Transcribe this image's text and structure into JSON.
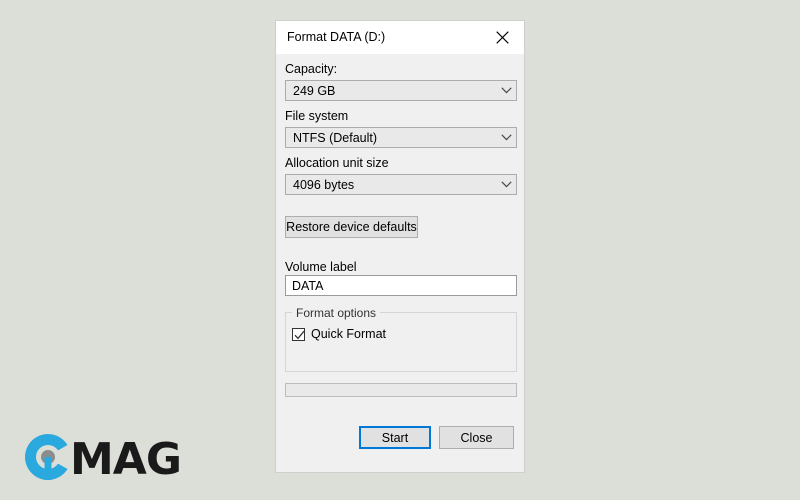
{
  "window": {
    "title": "Format DATA (D:)",
    "close_icon": "close-icon"
  },
  "fields": {
    "capacity": {
      "label": "Capacity:",
      "value": "249 GB",
      "arrow_icon": "chevron-down-icon"
    },
    "file_system": {
      "label": "File system",
      "value": "NTFS (Default)",
      "arrow_icon": "chevron-down-icon"
    },
    "allocation_unit_size": {
      "label": "Allocation unit size",
      "value": "4096 bytes",
      "arrow_icon": "chevron-down-icon"
    },
    "volume_label": {
      "label": "Volume label",
      "value": "DATA",
      "placeholder": ""
    }
  },
  "restore_defaults": {
    "label": "Restore device defaults"
  },
  "format_options": {
    "legend": "Format options",
    "quick_format": {
      "label": "Quick Format",
      "checked": true,
      "check_icon": "checkmark-icon"
    }
  },
  "progress": {
    "percent": 0
  },
  "footer": {
    "start_label": "Start",
    "close_label": "Close"
  },
  "watermark": {
    "text": "MAG",
    "logo_icon": "cmag-logo-icon",
    "accent_color": "#29a9de",
    "dot_color": "#8c8c8c"
  },
  "colors": {
    "focus_blue": "#0078d7",
    "page_background": "#dcdfd7",
    "dialog_background": "#f0f0f0",
    "titlebar_background": "#ffffff"
  }
}
